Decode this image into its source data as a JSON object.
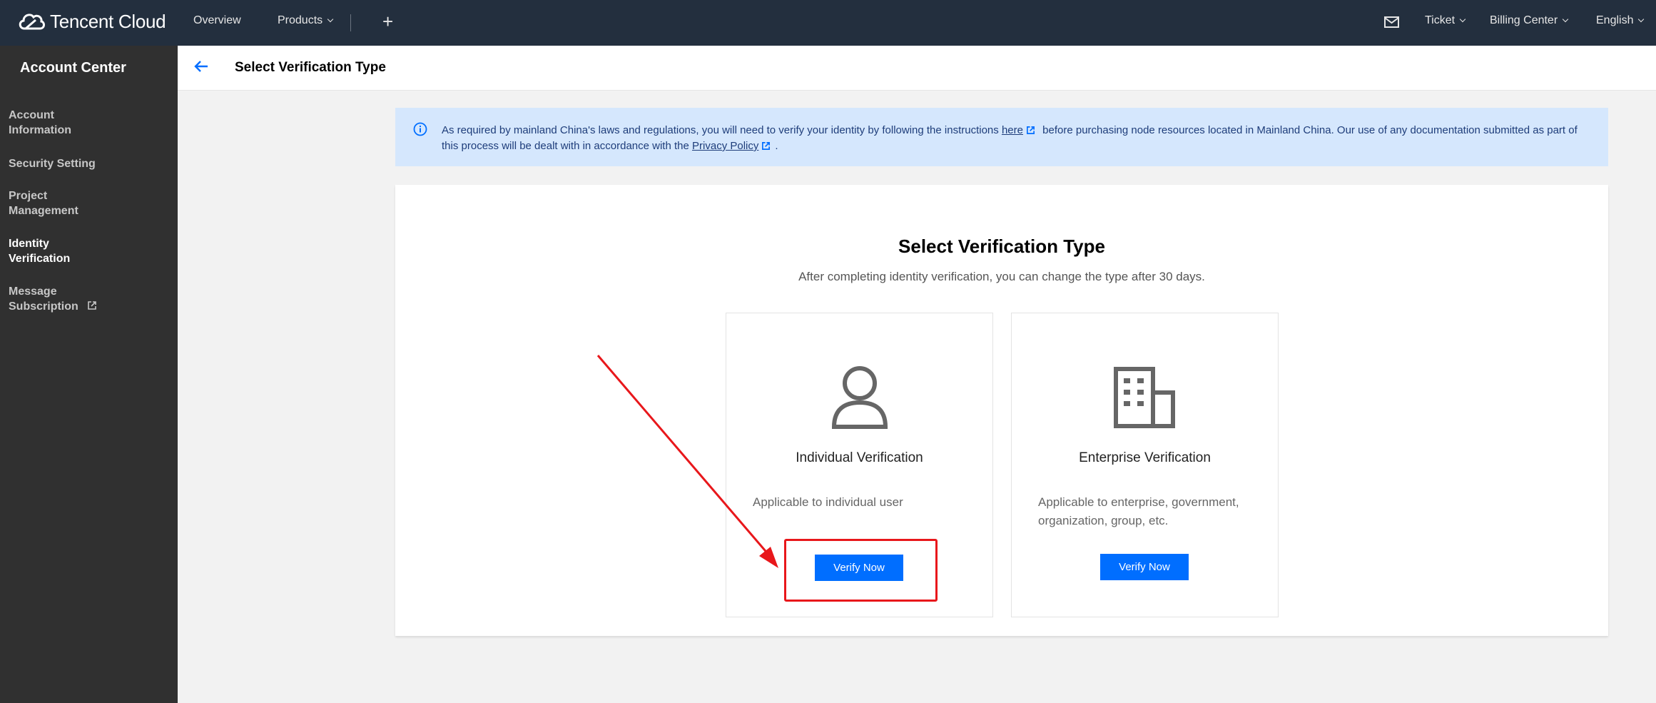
{
  "topbar": {
    "brand": "Tencent Cloud",
    "overview": "Overview",
    "products": "Products",
    "ticket": "Ticket",
    "billing": "Billing Center",
    "language": "English"
  },
  "sidebar": {
    "title": "Account Center",
    "items": [
      {
        "line1": "Account",
        "line2": "Information"
      },
      {
        "line1": "Security Setting",
        "line2": ""
      },
      {
        "line1": "Project",
        "line2": "Management"
      },
      {
        "line1": "Identity",
        "line2": "Verification"
      },
      {
        "line1": "Message",
        "line2": "Subscription"
      }
    ]
  },
  "header": {
    "title": "Select Verification Type"
  },
  "banner": {
    "text_before": "As required by mainland China's laws and regulations, you will need to verify your identity by following the instructions",
    "link_here": "here",
    "text_middle": "before purchasing node resources located in Mainland China. Our use of any documentation submitted as part of this process will be dealt with in accordance with the",
    "link_privacy": "Privacy Policy",
    "text_end": "."
  },
  "main": {
    "title": "Select Verification Type",
    "subtitle": "After completing identity verification, you can change the type after 30 days.",
    "cards": [
      {
        "icon": "person-icon",
        "title": "Individual Verification",
        "desc": "Applicable to individual user",
        "button": "Verify Now"
      },
      {
        "icon": "building-icon",
        "title": "Enterprise Verification",
        "desc": "Applicable to enterprise, government, organization, group, etc.",
        "button": "Verify Now"
      }
    ]
  },
  "colors": {
    "topbar": "#232f3e",
    "sidebar": "#303030",
    "primary": "#006eff",
    "banner": "#d5e7fd",
    "annotation": "#e8171b"
  }
}
